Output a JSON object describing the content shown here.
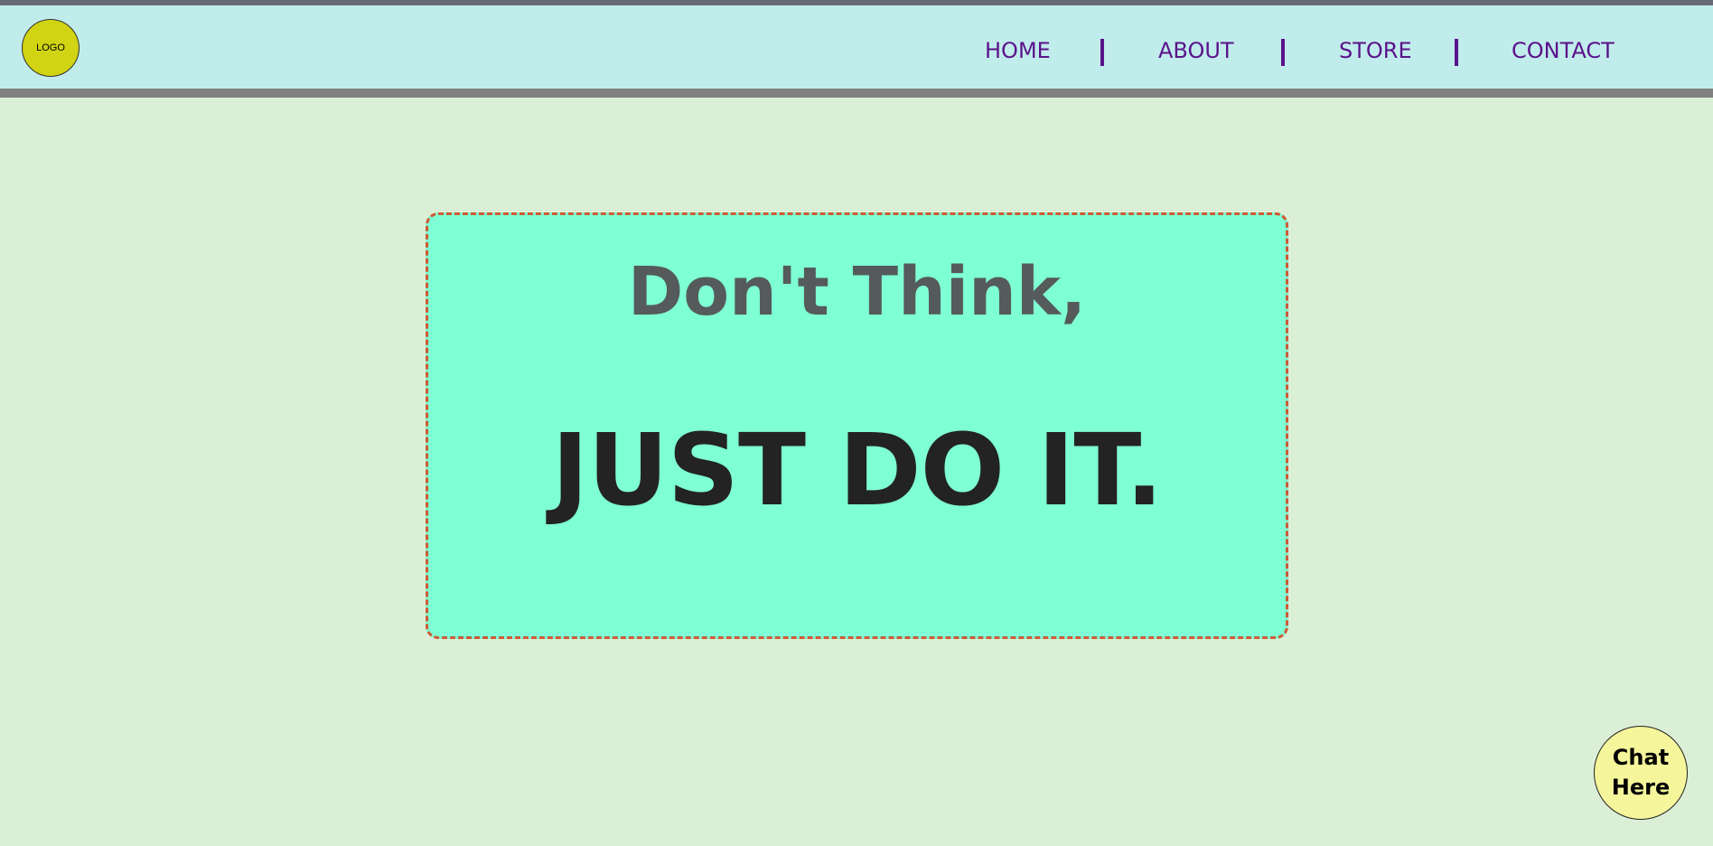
{
  "header": {
    "logo_text": "LOGO",
    "nav": [
      {
        "label": "HOME"
      },
      {
        "label": "ABOUT"
      },
      {
        "label": "STORE"
      },
      {
        "label": "CONTACT"
      }
    ]
  },
  "hero": {
    "line1": "Don't Think,",
    "line2": "JUST DO IT."
  },
  "chat": {
    "label_line1": "Chat",
    "label_line2": "Here"
  },
  "colors": {
    "page_bg": "#dbefd6",
    "header_bg": "#c1ecec",
    "nav_text": "#5a138a",
    "logo_bg": "#d0d412",
    "hero_bg": "#7fffd4",
    "hero_border": "#cd5a34",
    "chat_bg": "#f5f59b"
  }
}
